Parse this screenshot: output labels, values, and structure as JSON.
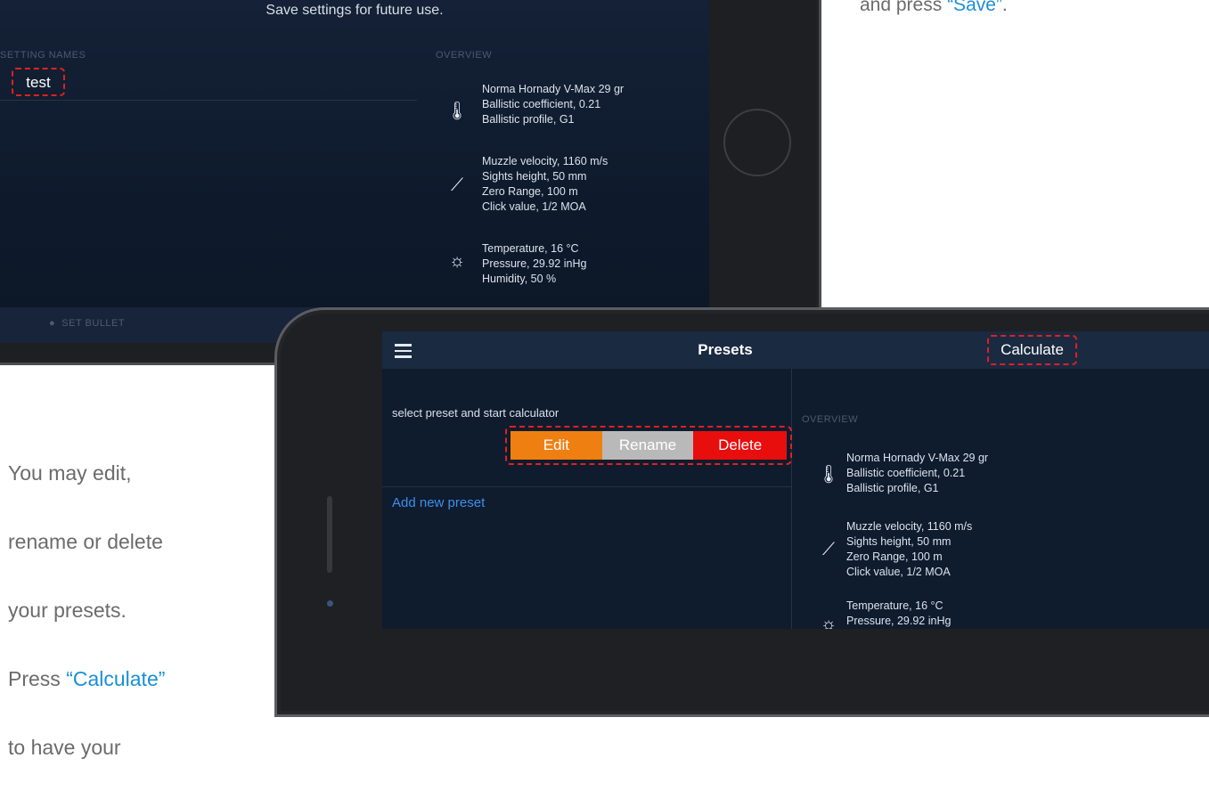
{
  "top_caption": {
    "prefix": "and press ",
    "highlight": "“Save”",
    "suffix": "."
  },
  "left_caption": {
    "line1": "You may edit,",
    "line2": "rename or delete",
    "line3": "your presets.",
    "press": "Press ",
    "highlight": "“Calculate”",
    "line5": "to have your"
  },
  "phone1": {
    "header": "Save settings for future use.",
    "setting_names_label": "SETTING NAMES",
    "overview_label": "OVERVIEW",
    "setting_value": "test",
    "bottom_tab": "SET BULLET",
    "overview": {
      "bullet": "Norma Hornady V-Max 29 gr\nBallistic coefficient, 0.21\nBallistic profile, G1",
      "rifle": "Muzzle velocity, 1160 m/s\nSights height, 50 mm\nZero Range, 100 m\nClick value, 1/2 MOA",
      "weather": "Temperature, 16 °C\nPressure, 29.92 inHg\nHumidity, 50 %"
    }
  },
  "phone2": {
    "title": "Presets",
    "calculate_label": "Calculate",
    "hint": "select preset and start calculator",
    "actions": {
      "edit": "Edit",
      "rename": "Rename",
      "delete": "Delete"
    },
    "add_new_preset": "Add new preset",
    "overview_label": "OVERVIEW",
    "overview": {
      "bullet": "Norma Hornady V-Max 29 gr\nBallistic coefficient, 0.21\nBallistic profile, G1",
      "rifle": "Muzzle velocity, 1160 m/s\nSights height, 50 mm\nZero Range, 100 m\nClick value, 1/2 MOA",
      "weather": "Temperature, 16 °C\nPressure, 29.92 inHg"
    }
  },
  "colors": {
    "edit": "#f07f12",
    "rename": "#b9b9b9",
    "delete": "#e80e0e",
    "link": "#3f8ee8",
    "highlight": "#1a8fd8",
    "dash": "#e02020"
  }
}
